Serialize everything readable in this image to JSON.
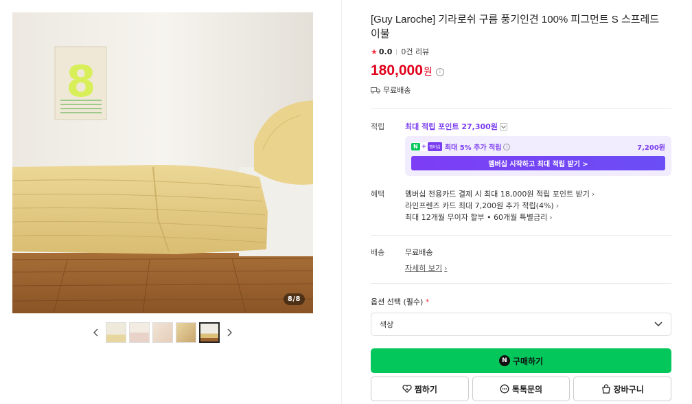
{
  "gallery": {
    "page_counter": "8/8",
    "thumbnail_count": 5,
    "active_thumbnail": 5,
    "calendar_number": "8"
  },
  "product": {
    "title": "[Guy Laroche] 기라로쉬 구름 풍기인견 100% 피그먼트 S 스프레드 이불",
    "rating": "0.0",
    "review_count": "0건 리뷰",
    "price": "180,000",
    "price_unit": "원",
    "shipping_summary": "무료배송"
  },
  "points": {
    "label": "적립",
    "max_points": "최대 적립 포인트 27,300원",
    "membership_badge_text": "멤버십",
    "extra_text": "최대 5% 추가 적립",
    "extra_amount": "7,200원",
    "member_button": "멤버십 시작하고 최대 적립 받기 >"
  },
  "benefits": {
    "label": "혜택",
    "lines": [
      "멤버십 전용카드 결제 시 최대 18,000원 적립 포인트 받기",
      "라인프렌즈 카드 최대 7,200원 추가 적립(4%)",
      "최대 12개월 무이자 할부 • 60개월 특별금리"
    ]
  },
  "delivery": {
    "label": "배송",
    "value": "무료배송",
    "detail_link": "자세히 보기"
  },
  "options": {
    "label": "옵션 선택 (필수)",
    "required_mark": "*",
    "select_value": "색상"
  },
  "actions": {
    "buy": "구매하기",
    "wish": "찜하기",
    "talk": "톡톡문의",
    "cart": "장바구니"
  },
  "colors": {
    "price_red": "#e0001b",
    "naver_green": "#03c75a",
    "membership_purple": "#7a3cf0"
  }
}
